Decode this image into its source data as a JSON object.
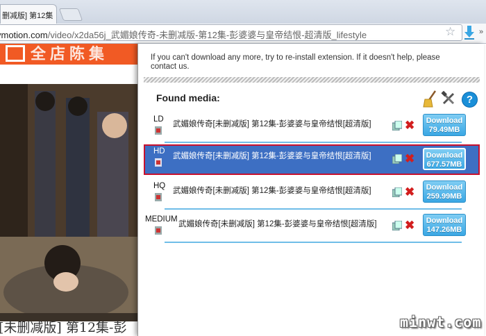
{
  "tab": {
    "title": "删减版] 第12集",
    "close": "×"
  },
  "address": {
    "host": "ymotion.com",
    "path": "/video/x2da56j_武媚娘传奇-未删减版-第12集-彭婆婆与皇帝结恨-超清版_lifestyle"
  },
  "toolbar": {
    "more": "»"
  },
  "page": {
    "banner_text": "全店陈集",
    "caption": "[未删减版] 第12集-彭"
  },
  "popup": {
    "notice": "If you can't download any more, try to re-install extension. If it doesn't help, please contact us.",
    "found_label": "Found media:",
    "help_label": "?",
    "delete_glyph": "✖",
    "download_label": "Download",
    "items": [
      {
        "quality": "LD",
        "title": "武媚娘传奇[未删减版] 第12集-彭婆婆与皇帝结恨[超清版]",
        "size": "79.49MB",
        "selected": false
      },
      {
        "quality": "HD",
        "title": "武媚娘传奇[未删减版] 第12集-彭婆婆与皇帝结恨[超清版]",
        "size": "677.57MB",
        "selected": true
      },
      {
        "quality": "HQ",
        "title": "武媚娘传奇[未删减版] 第12集-彭婆婆与皇帝结恨[超清版]",
        "size": "259.99MB",
        "selected": false
      },
      {
        "quality": "MEDIUM",
        "title": "武媚娘传奇[未删减版] 第12集-彭婆婆与皇帝结恨[超清版]",
        "size": "147.26MB",
        "selected": false
      }
    ]
  },
  "watermark": "minwt.com",
  "colors": {
    "accent": "#3aa7e4",
    "selected_row": "#3d6fc3",
    "selected_border": "#c8102e",
    "delete": "#d21e1e",
    "banner": "#f15a24"
  }
}
